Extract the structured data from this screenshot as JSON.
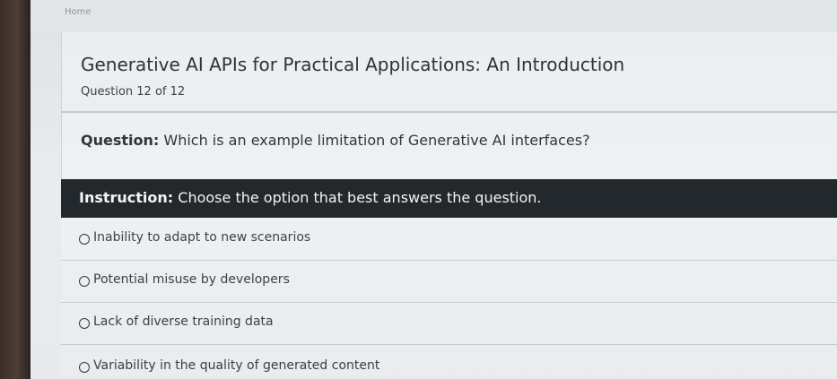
{
  "breadcrumb": {
    "home_label": "Home"
  },
  "course": {
    "title": "Generative AI APIs for Practical Applications: An Introduction",
    "progress_text": "Question 12 of 12"
  },
  "question": {
    "label": "Question:",
    "text": " Which is an example limitation of Generative AI interfaces?"
  },
  "instruction": {
    "label": "Instruction:",
    "text": " Choose the option that best answers the question."
  },
  "options": [
    {
      "label": "Inability to adapt to new scenarios"
    },
    {
      "label": "Potential misuse by developers"
    },
    {
      "label": "Lack of diverse training data"
    },
    {
      "label": "Variability in the quality of generated content"
    }
  ],
  "colors": {
    "instruction_bar_bg": "#1f2429",
    "panel_bg": "#eef0f2",
    "text_primary": "#2e3338"
  },
  "icons": {
    "radio": "radio-unchecked-icon"
  }
}
